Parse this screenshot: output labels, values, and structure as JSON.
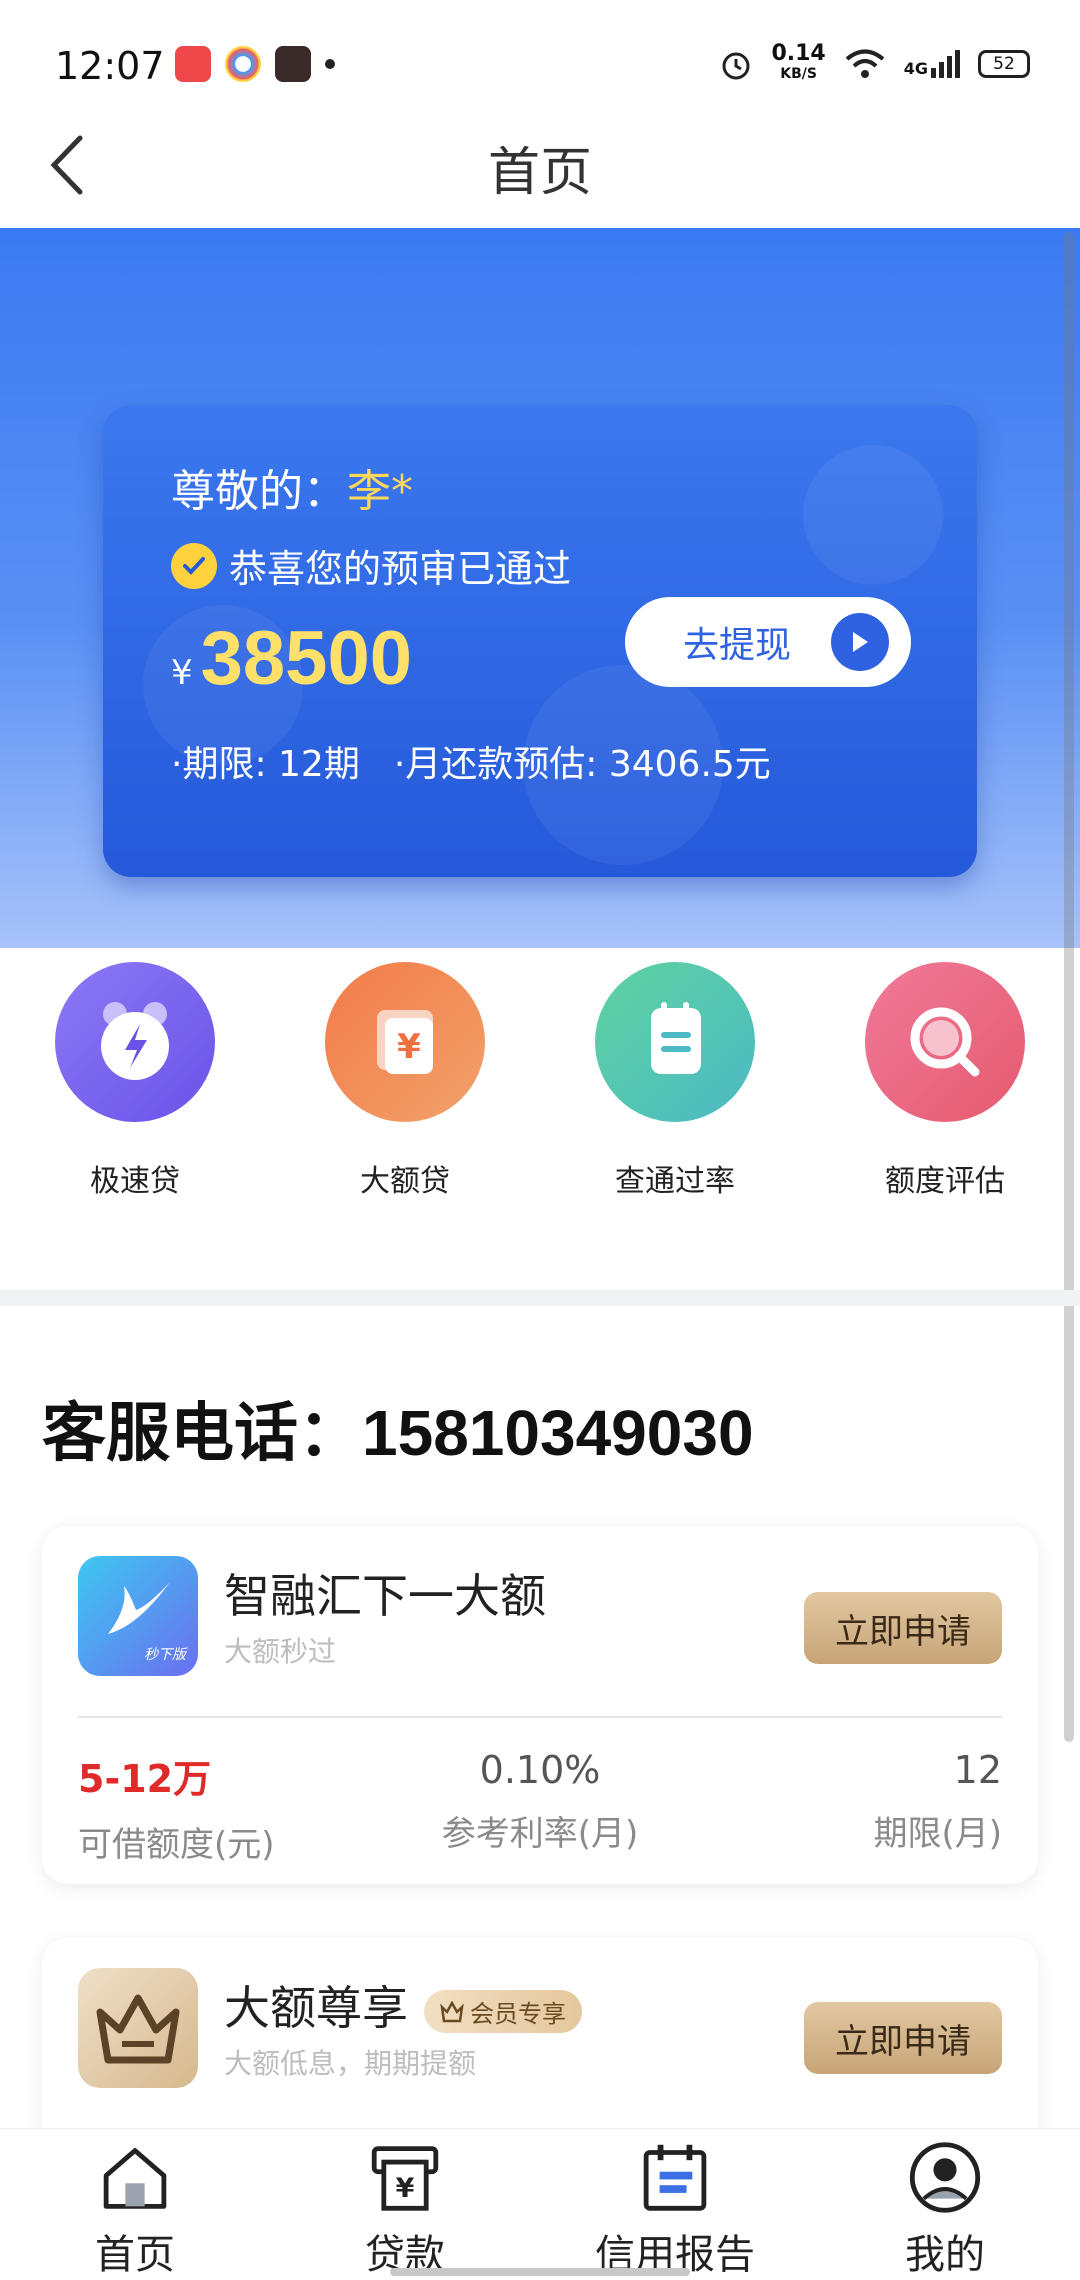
{
  "status_bar": {
    "time": "12:07",
    "net_speed_value": "0.14",
    "net_speed_unit": "KB/S",
    "signal_label": "4G",
    "battery": "52"
  },
  "header": {
    "title": "首页"
  },
  "loan_card": {
    "greeting_prefix": "尊敬的：",
    "name": "李*",
    "approved_text": "恭喜您的预审已通过",
    "currency": "¥",
    "amount": "38500",
    "term": "·期限: 12期",
    "monthly": "·月还款预估: 3406.5元",
    "withdraw_label": "去提现"
  },
  "quick_actions": [
    {
      "label": "极速贷",
      "icon": "alarm-clock-icon"
    },
    {
      "label": "大额贷",
      "icon": "yuan-card-icon"
    },
    {
      "label": "查通过率",
      "icon": "notepad-icon"
    },
    {
      "label": "额度评估",
      "icon": "magnifier-icon"
    }
  ],
  "hotline": {
    "label": "客服电话：",
    "number": "15810349030"
  },
  "products": [
    {
      "title": "智融汇下一大额",
      "subtitle": "大额秒过",
      "logo_text": "秒下版",
      "apply_label": "立即申请",
      "amount_range": "5-12万",
      "amount_label": "可借额度(元)",
      "rate": "0.10%",
      "rate_label": "参考利率(月)",
      "term": "12",
      "term_label": "期限(月)"
    },
    {
      "title": "大额尊享",
      "badge": "会员专享",
      "subtitle": "大额低息，期期提额",
      "apply_label": "立即申请"
    }
  ],
  "bottom_nav": [
    {
      "label": "首页",
      "icon": "home-icon"
    },
    {
      "label": "贷款",
      "icon": "loan-icon"
    },
    {
      "label": "信用报告",
      "icon": "calendar-report-icon"
    },
    {
      "label": "我的",
      "icon": "person-icon"
    }
  ],
  "colors": {
    "primary_blue": "#2f62e0",
    "gold": "#ffd85a",
    "apply_button": "#c7a477",
    "accent_red": "#e02a2a"
  }
}
